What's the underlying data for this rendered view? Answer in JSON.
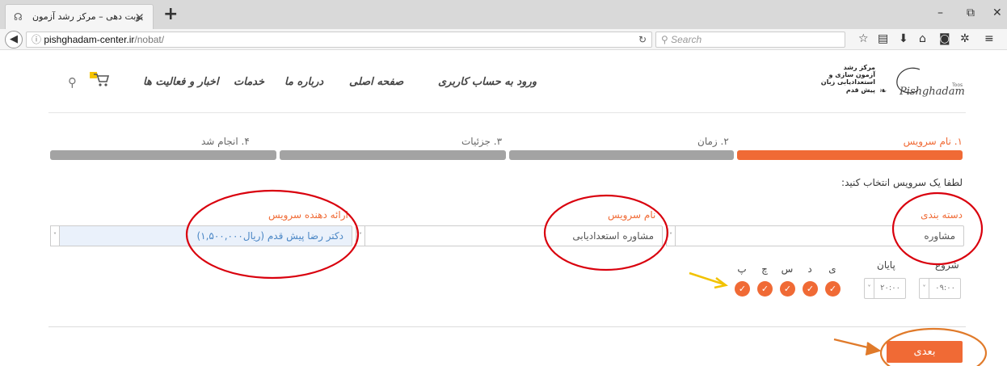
{
  "browser": {
    "tab_title": "نوبت دهی – مرکز رشد آزمون",
    "tab_close": "×",
    "new_tab": "+",
    "url_host": "pishghadam-center.ir",
    "url_path": "/nobat/",
    "search_placeholder": "Search",
    "window_min": "–",
    "window_restore": "⧉",
    "window_close": "✕"
  },
  "site": {
    "menu": {
      "login": "ورود به حساب کاربری",
      "home": "صفحه اصلی",
      "about": "درباره ما",
      "services": "خدمات",
      "news": "اخبار و فعالیت ها"
    },
    "logo": {
      "line1": "مرکز رشد",
      "line2": "آزمون سازی و",
      "line3": "استعدادیابی زبان",
      "line4": "پیش قدم",
      "brand": "Pishghadam",
      "brand_suffix": "Toos"
    }
  },
  "steps": [
    {
      "label": "۱. نام سرویس",
      "active": true
    },
    {
      "label": "۲. زمان",
      "active": false
    },
    {
      "label": "۳. جزئیات",
      "active": false
    },
    {
      "label": "۴. انجام شد",
      "active": false
    }
  ],
  "form": {
    "instruction": "لطفا یک سرویس انتخاب کنید:",
    "category_label": "دسته بندی",
    "category_value": "مشاوره",
    "service_label": "نام سرویس",
    "service_value": "مشاوره استعدادیابی",
    "provider_label": "ارائه دهنده سرویس",
    "provider_value": "دکتر رضا پیش قدم (ریال۱,۵۰۰,۰۰۰)",
    "start_label": "شروع",
    "start_value": "۰۹:۰۰",
    "end_label": "پایان",
    "end_value": "۲۰:۰۰",
    "days": [
      "ی",
      "د",
      "س",
      "چ",
      "پ"
    ],
    "next_button": "بعدی"
  },
  "colors": {
    "accent": "#f06a35",
    "annotation_red": "#d9000d",
    "annotation_yellow": "#f2c200",
    "annotation_orange": "#e07a2a"
  }
}
